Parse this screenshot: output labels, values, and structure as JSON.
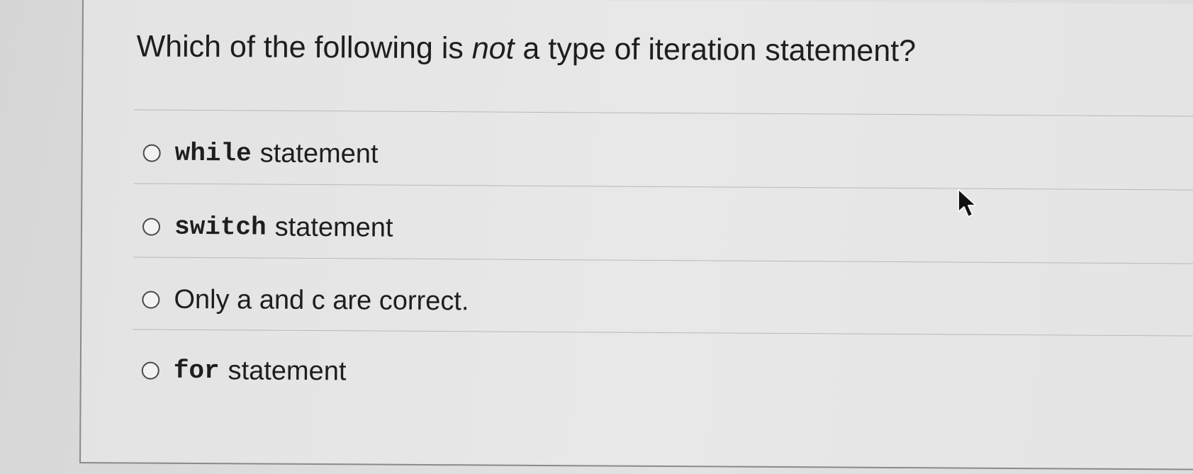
{
  "question": {
    "prefix": "Which of the following is ",
    "emphasis": "not",
    "suffix": " a type of iteration statement?"
  },
  "options": [
    {
      "code": "while",
      "text": "statement"
    },
    {
      "code": "switch",
      "text": "statement"
    },
    {
      "code": "",
      "text": "Only a and c are correct."
    },
    {
      "code": "for",
      "text": "statement"
    }
  ],
  "icons": {
    "radio": "radio-unselected-icon",
    "cursor": "mouse-pointer-icon"
  },
  "colors": {
    "text": "#1e1e1e",
    "divider": "#b9b9b9",
    "background": "#e3e3e3"
  }
}
